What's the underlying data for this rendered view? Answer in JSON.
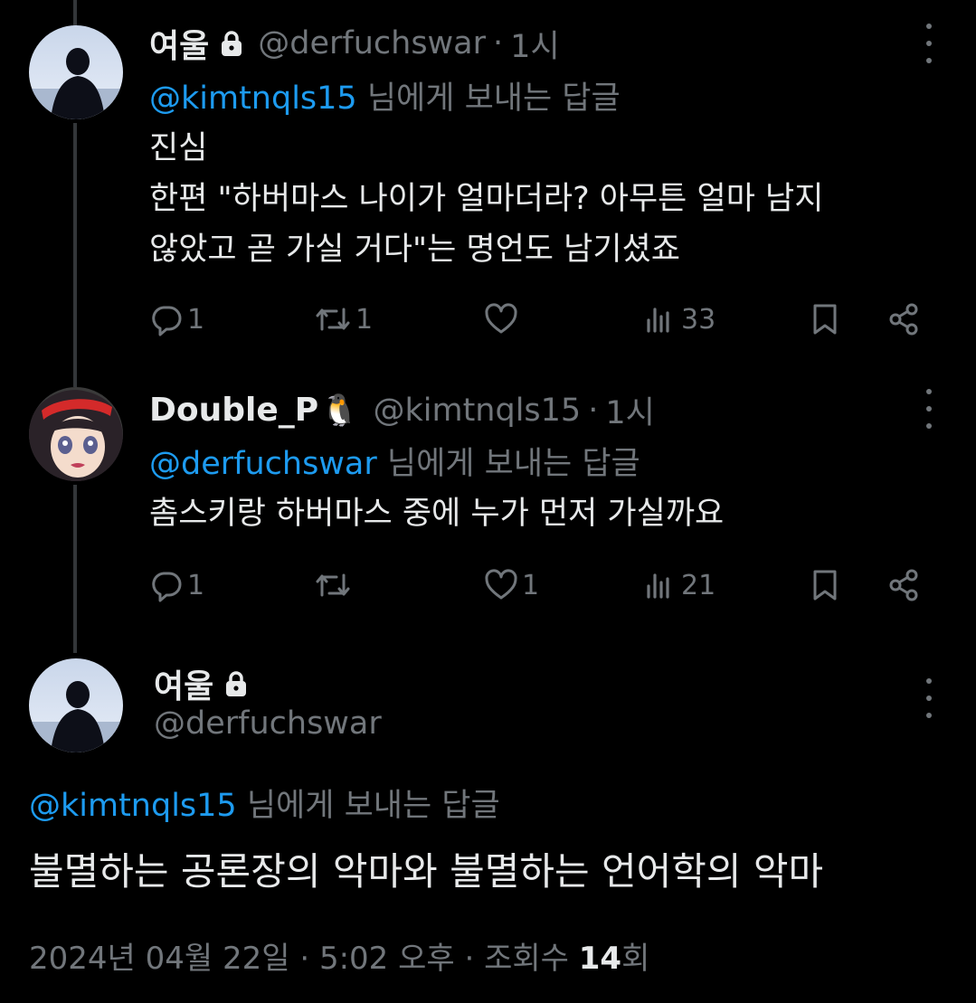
{
  "replies": [
    {
      "name": "여울",
      "locked": true,
      "handle": "@derfuchswar",
      "separator": "·",
      "time": "1시",
      "reply_to_mention": "@kimtnqls15",
      "reply_to_suffix": " 님에게 보내는 답글",
      "lines": [
        "진심",
        "한편 \"하버마스 나이가 얼마더라? 아무튼 얼마 남지",
        "않았고 곧 가실 거다\"는 명언도 남기셨죠"
      ],
      "reply_count": "1",
      "repost_count": "1",
      "like_count": "",
      "view_count": "33"
    },
    {
      "name": "Double_P",
      "emoji": "🐧",
      "handle": "@kimtnqls15",
      "separator": "·",
      "time": "1시",
      "reply_to_mention": "@derfuchswar",
      "reply_to_suffix": " 님에게 보내는 답글",
      "lines": [
        "촘스키랑 하버마스 중에 누가 먼저 가실까요"
      ],
      "reply_count": "1",
      "repost_count": "",
      "like_count": "1",
      "view_count": "21"
    }
  ],
  "main": {
    "name": "여울",
    "handle": "@derfuchswar",
    "reply_to_mention": "@kimtnqls15",
    "reply_to_suffix": " 님에게 보내는 답글",
    "text": "불멸하는 공론장의 악마와 불멸하는 언어학의 악마",
    "date": "2024년 04월 22일",
    "separator": "·",
    "time": "5:02 오후",
    "views_label": "조회수",
    "views_count": "14",
    "views_unit": "회"
  },
  "colors": {
    "background": "#000000",
    "text": "#e7e9ea",
    "muted": "#71767b",
    "link": "#1d9bf0",
    "thread_line": "#333639"
  },
  "icons": [
    "lock-icon",
    "more-icon",
    "reply-icon",
    "repost-icon",
    "like-icon",
    "views-icon",
    "bookmark-icon",
    "share-icon"
  ]
}
